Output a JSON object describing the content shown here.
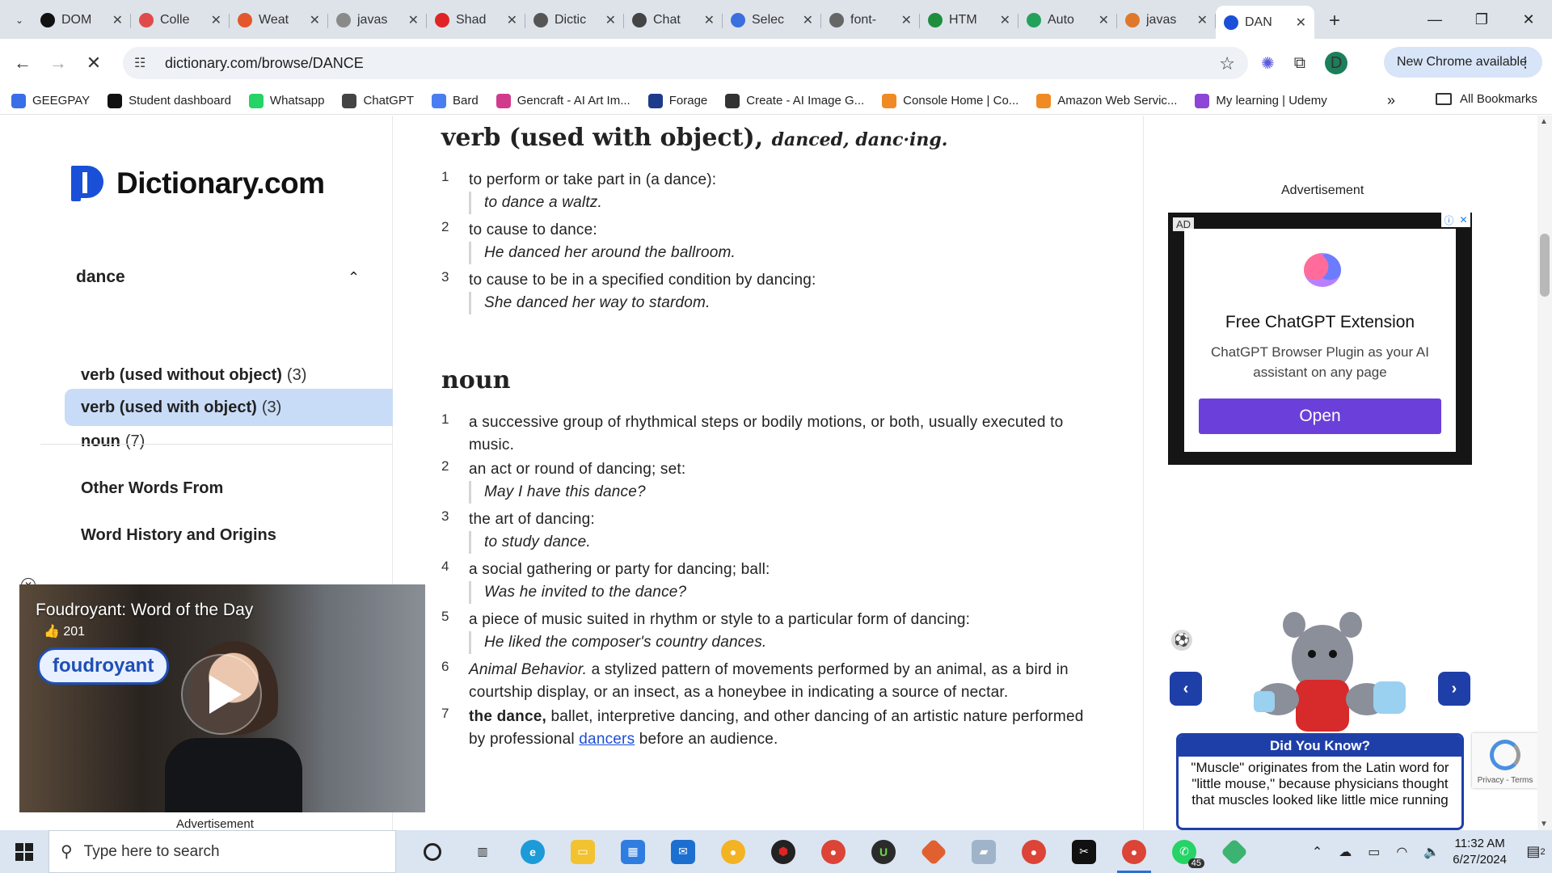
{
  "browser": {
    "tabs": [
      {
        "title": "DOM",
        "icon": "github-icon",
        "color": "#111111"
      },
      {
        "title": "Colle",
        "icon": "collection-icon",
        "color": "#e04a4a"
      },
      {
        "title": "Weat",
        "icon": "weather-icon",
        "color": "#e3572b"
      },
      {
        "title": "javas",
        "icon": "javascript-icon",
        "color": "#8a8a8a"
      },
      {
        "title": "Shad",
        "icon": "youtube-icon",
        "color": "#e02424"
      },
      {
        "title": "Dictic",
        "icon": "dictionary-icon",
        "color": "#555555"
      },
      {
        "title": "Chat",
        "icon": "chatgpt-icon",
        "color": "#444444"
      },
      {
        "title": "Selec",
        "icon": "select-icon",
        "color": "#3b6fe0"
      },
      {
        "title": "font-",
        "icon": "code-icon",
        "color": "#666666"
      },
      {
        "title": "HTM",
        "icon": "w3schools-icon",
        "color": "#1e8e3e"
      },
      {
        "title": "Auto",
        "icon": "auto-icon",
        "color": "#23a15b"
      },
      {
        "title": "javas",
        "icon": "javascript-icon",
        "color": "#e0782b"
      },
      {
        "title": "DAN",
        "icon": "dictionary-icon",
        "color": "#1a4fd8",
        "active": true
      }
    ],
    "address": "dictionary.com/browse/DANCE",
    "new_chrome_label": "New Chrome available",
    "profile_initial": "D",
    "bookmarks": [
      {
        "label": "GEEGPAY",
        "color": "#3a6ee8"
      },
      {
        "label": "Student dashboard",
        "color": "#111111"
      },
      {
        "label": "Whatsapp",
        "color": "#25d366"
      },
      {
        "label": "ChatGPT",
        "color": "#444444"
      },
      {
        "label": "Bard",
        "color": "#4a7df0"
      },
      {
        "label": "Gencraft - AI Art Im...",
        "color": "#d13b8c"
      },
      {
        "label": "Forage",
        "color": "#1e3a8a"
      },
      {
        "label": "Create - AI Image G...",
        "color": "#333333"
      },
      {
        "label": "Console Home | Co...",
        "color": "#f08a24"
      },
      {
        "label": "Amazon Web Servic...",
        "color": "#f08a24"
      },
      {
        "label": "My learning | Udemy",
        "color": "#8e44d6"
      }
    ],
    "all_bookmarks_label": "All Bookmarks"
  },
  "site": {
    "logo_text": "Dictionary.com",
    "sidebar": {
      "section_title": "dance",
      "items": [
        {
          "label": "verb (used without object)",
          "count": "(3)"
        },
        {
          "label": "verb (used with object)",
          "count": "(3)",
          "selected": true
        },
        {
          "label": "noun",
          "count": "(7)"
        }
      ],
      "links": [
        "Other Words From",
        "Word History and Origins"
      ]
    },
    "entry": {
      "verb_heading": "verb (used with object),",
      "verb_forms": "danced, danc·ing.",
      "verb_defs": [
        {
          "n": "1",
          "text": "to perform or take part in (a dance):",
          "example": "to dance a waltz."
        },
        {
          "n": "2",
          "text": "to cause to dance:",
          "example": "He danced her around the ballroom."
        },
        {
          "n": "3",
          "text": "to cause to be in a specified condition by dancing:",
          "example": "She danced her way to stardom."
        }
      ],
      "noun_heading": "noun",
      "noun_defs": [
        {
          "n": "1",
          "text": "a successive group of rhythmical steps or bodily motions, or both, usually executed to music."
        },
        {
          "n": "2",
          "text": "an act or round of dancing; set:",
          "example": "May I have this dance?"
        },
        {
          "n": "3",
          "text": "the art of dancing:",
          "example": "to study dance."
        },
        {
          "n": "4",
          "text": "a social gathering or party for dancing; ball:",
          "example": "Was he invited to the dance?"
        },
        {
          "n": "5",
          "text": "a piece of music suited in rhythm or style to a particular form of dancing:",
          "example": "He liked the composer's country dances."
        },
        {
          "n": "6",
          "label": "Animal Behavior.",
          "text": "a stylized pattern of movements performed by an animal, as a bird in courtship display, or an insect, as a honeybee in indicating a source of nectar."
        },
        {
          "n": "7",
          "bold": "the dance,",
          "text": "ballet, interpretive dancing, and other dancing of an artistic nature performed by professional",
          "link": "dancers",
          "tail": "before an audience."
        }
      ]
    },
    "ad": {
      "label": "Advertisement",
      "tag": "AD",
      "title": "Free ChatGPT Extension",
      "body": "ChatGPT Browser Plugin as your AI assistant on any page",
      "button": "Open"
    },
    "did_you_know": {
      "title": "Did You Know?",
      "text": "\"Muscle\" originates from the Latin word for \"little mouse,\" because physicians thought that muscles looked like little mice running"
    },
    "recaptcha_text": "Privacy - Terms",
    "video": {
      "title": "Foudroyant: Word of the Day",
      "likes": "201",
      "chip": "foudroyant",
      "ad_label": "Advertisement"
    }
  },
  "taskbar": {
    "search_placeholder": "Type here to search",
    "time": "11:32 AM",
    "date": "6/27/2024",
    "whatsapp_badge": "45",
    "notif_count": "2"
  }
}
